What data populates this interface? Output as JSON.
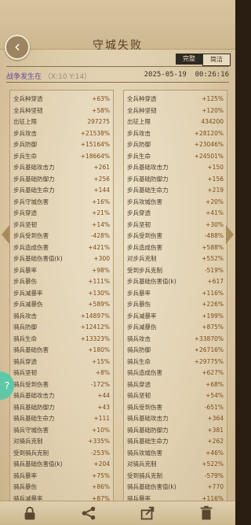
{
  "header": {
    "title": "守城失败"
  },
  "tabs": [
    {
      "label": "完整"
    },
    {
      "label": "简洁"
    }
  ],
  "meta": {
    "location": "战争发生在",
    "coords": "（X:10 Y:14）",
    "date": "2025-05-19",
    "time": "00:26:16"
  },
  "left_rows": [
    {
      "label": "全兵种穿透",
      "value": "+63%"
    },
    {
      "label": "全兵种坚韧",
      "value": "+58%"
    },
    {
      "label": "出征上限",
      "value": "297275"
    },
    {
      "label": "步兵攻击",
      "value": "+21538%"
    },
    {
      "label": "步兵防御",
      "value": "+15164%"
    },
    {
      "label": "步兵生命",
      "value": "+18664%"
    },
    {
      "label": "步兵基础攻击力",
      "value": "+261"
    },
    {
      "label": "步兵基础防御力",
      "value": "+256"
    },
    {
      "label": "步兵基础生命力",
      "value": "+144"
    },
    {
      "label": "步兵守城伤害",
      "value": "+16%"
    },
    {
      "label": "步兵穿透",
      "value": "+21%"
    },
    {
      "label": "步兵坚韧",
      "value": "+14%"
    },
    {
      "label": "步兵受到伤害",
      "value": "-428%"
    },
    {
      "label": "步兵造成伤害",
      "value": "+421%"
    },
    {
      "label": "步兵基础伤害值(k)",
      "value": "+300"
    },
    {
      "label": "步兵暴率",
      "value": "+98%"
    },
    {
      "label": "步兵暴伤",
      "value": "+111%"
    },
    {
      "label": "步兵减暴率",
      "value": "+130%"
    },
    {
      "label": "步兵减暴伤",
      "value": "+589%"
    },
    {
      "label": "骑兵攻击",
      "value": "+14897%"
    },
    {
      "label": "骑兵防御",
      "value": "+12412%"
    },
    {
      "label": "骑兵生命",
      "value": "+13323%"
    },
    {
      "label": "骑兵基础伤害",
      "value": "+180%"
    },
    {
      "label": "骑兵穿透",
      "value": "+15%"
    },
    {
      "label": "骑兵坚韧",
      "value": "+8%"
    },
    {
      "label": "骑兵受到伤害",
      "value": "-172%"
    },
    {
      "label": "骑兵基础攻击力",
      "value": "+44"
    },
    {
      "label": "骑兵基础防御力",
      "value": "+43"
    },
    {
      "label": "骑兵基础生命力",
      "value": "+111"
    },
    {
      "label": "骑兵守城伤害",
      "value": "+10%"
    },
    {
      "label": "对骑兵克制",
      "value": "+335%"
    },
    {
      "label": "受到骑兵克制",
      "value": "-253%"
    },
    {
      "label": "骑兵基础伤害值(k)",
      "value": "+204"
    },
    {
      "label": "骑兵暴率",
      "value": "+75%"
    },
    {
      "label": "骑兵暴伤",
      "value": "+86%"
    },
    {
      "label": "骑兵减暴率",
      "value": "+87%"
    },
    {
      "label": "骑兵减暴伤",
      "value": "+489%"
    }
  ],
  "right_rows": [
    {
      "label": "全兵种穿透",
      "value": "+125%"
    },
    {
      "label": "全兵种坚韧",
      "value": "+120%"
    },
    {
      "label": "出征上限",
      "value": "434200"
    },
    {
      "label": "步兵攻击",
      "value": "+28120%"
    },
    {
      "label": "步兵防御",
      "value": "+23046%"
    },
    {
      "label": "步兵生命",
      "value": "+24501%"
    },
    {
      "label": "步兵基础攻击力",
      "value": "+150"
    },
    {
      "label": "步兵基础防御力",
      "value": "+156"
    },
    {
      "label": "步兵基础生命力",
      "value": "+219"
    },
    {
      "label": "步兵攻城伤害",
      "value": "+20%"
    },
    {
      "label": "步兵穿透",
      "value": "+41%"
    },
    {
      "label": "步兵坚韧",
      "value": "+30%"
    },
    {
      "label": "步兵受到伤害",
      "value": "-488%"
    },
    {
      "label": "步兵造成伤害",
      "value": "+588%"
    },
    {
      "label": "对步兵克制",
      "value": "+552%"
    },
    {
      "label": "受到步兵克制",
      "value": "-519%"
    },
    {
      "label": "步兵基础伤害值(k)",
      "value": "+617"
    },
    {
      "label": "步兵暴率",
      "value": "+116%"
    },
    {
      "label": "步兵暴伤",
      "value": "+226%"
    },
    {
      "label": "步兵减暴率",
      "value": "+199%"
    },
    {
      "label": "步兵减暴伤",
      "value": "+875%"
    },
    {
      "label": "骑兵攻击",
      "value": "+33870%"
    },
    {
      "label": "骑兵防御",
      "value": "+26716%"
    },
    {
      "label": "骑兵生命",
      "value": "+29775%"
    },
    {
      "label": "骑兵造成伤害",
      "value": "+627%"
    },
    {
      "label": "骑兵穿透",
      "value": "+68%"
    },
    {
      "label": "骑兵坚韧",
      "value": "+54%"
    },
    {
      "label": "骑兵受到伤害",
      "value": "-651%"
    },
    {
      "label": "骑兵基础攻击力",
      "value": "+364"
    },
    {
      "label": "骑兵基础防御力",
      "value": "+381"
    },
    {
      "label": "骑兵基础生命力",
      "value": "+262"
    },
    {
      "label": "骑兵攻城伤害",
      "value": "+46%"
    },
    {
      "label": "对骑兵克制",
      "value": "+522%"
    },
    {
      "label": "受到骑兵克制",
      "value": "-579%"
    },
    {
      "label": "骑兵基础伤害值(k)",
      "value": "+770"
    },
    {
      "label": "骑兵暴率",
      "value": "+116%"
    },
    {
      "label": "骑兵暴伤",
      "value": "+226%"
    }
  ],
  "icons": [
    "back-icon",
    "lock-icon",
    "share-icon",
    "export-icon",
    "trash-icon"
  ]
}
